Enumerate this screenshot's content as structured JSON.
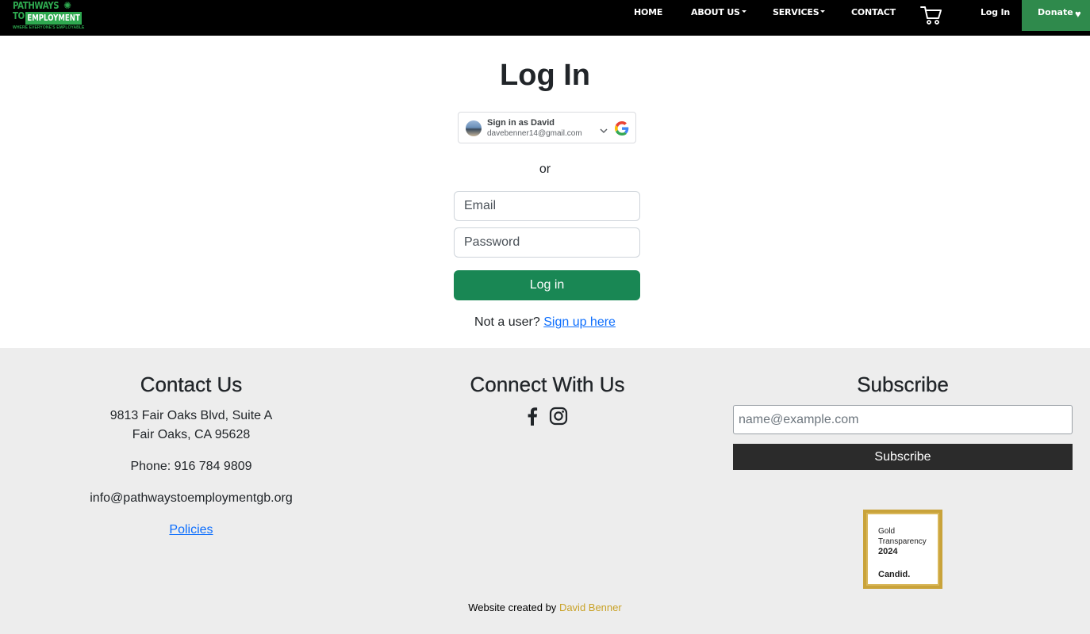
{
  "nav": {
    "logo_line1": "PATHWAYS",
    "logo_line2": "TO",
    "logo_line3": "EMPLOYMENT",
    "logo_tagline": "WHERE EVERYONE'S EMPLOYABLE",
    "home": "HOME",
    "about": "ABOUT US",
    "services": "SERVICES",
    "contact": "CONTACT",
    "login": "Log In",
    "donate": "Donate"
  },
  "login": {
    "title": "Log In",
    "google_name": "Sign in as David",
    "google_email": "davebenner14@gmail.com",
    "or": "or",
    "email_placeholder": "Email",
    "password_placeholder": "Password",
    "submit": "Log in",
    "not_user": "Not a user?",
    "signup_link": "Sign up here"
  },
  "footer": {
    "contact_title": "Contact Us",
    "address1": "9813 Fair Oaks Blvd, Suite A",
    "address2": "Fair Oaks, CA 95628",
    "phone": "Phone: 916 784 9809",
    "email": "info@pathwaystoemploymentgb.org",
    "policies": "Policies",
    "connect_title": "Connect With Us",
    "subscribe_title": "Subscribe",
    "subscribe_placeholder": "name@example.com",
    "subscribe_button": "Subscribe",
    "seal_line1": "Gold",
    "seal_line2": "Transparency",
    "seal_year": "2024",
    "seal_brand": "Candid.",
    "credit_prefix": "Website created by",
    "credit_name": "David Benner"
  },
  "colors": {
    "brand_green": "#2ea84f",
    "donate_green": "#2f8a4c",
    "login_button": "#198754",
    "link_blue": "#0d6efd",
    "credit_gold": "#c9a227",
    "footer_bg": "#ededed"
  },
  "icons": [
    "cart-icon",
    "heart-icon",
    "google-icon",
    "chevron-down-icon",
    "facebook-icon",
    "instagram-icon"
  ]
}
